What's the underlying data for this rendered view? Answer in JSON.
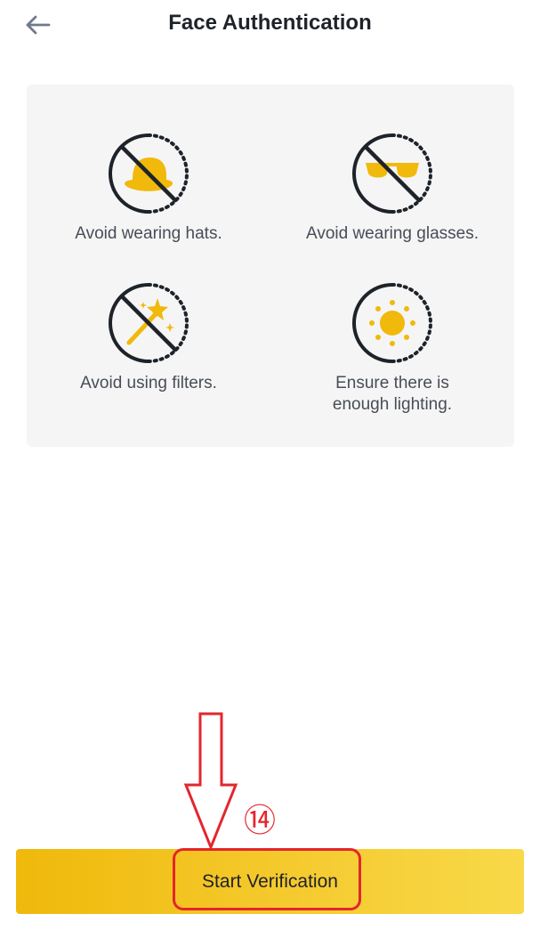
{
  "header": {
    "title": "Face Authentication",
    "back_icon": "arrow-left-icon"
  },
  "tips": [
    {
      "icon": "no-hat-icon",
      "label": "Avoid wearing hats."
    },
    {
      "icon": "no-glasses-icon",
      "label": "Avoid wearing glasses."
    },
    {
      "icon": "no-filter-icon",
      "label": "Avoid using filters."
    },
    {
      "icon": "lighting-icon",
      "label": "Ensure there is\nenough lighting."
    }
  ],
  "footer": {
    "start_label": "Start Verification"
  },
  "annotation": {
    "step_marker": "⑭",
    "color": "#e3262d"
  },
  "colors": {
    "accent": "#f0b90b",
    "icon_fill": "#f0b90b",
    "icon_stroke": "#1e2329",
    "card_bg": "#f5f5f5"
  }
}
